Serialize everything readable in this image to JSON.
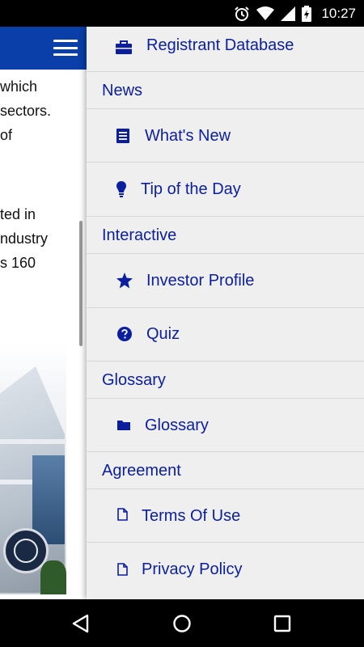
{
  "status_bar": {
    "time": "10:27",
    "icons": [
      "alarm-icon",
      "wifi-icon",
      "cellular-signal-icon",
      "battery-charging-icon"
    ]
  },
  "background_page": {
    "text_lines": [
      "which",
      "sectors.",
      "of",
      "ted in",
      "ndustry",
      "s 160"
    ],
    "menu_icon": "hamburger-icon",
    "header_color": "#0a3ea8"
  },
  "drawer": {
    "accent_color": "#0b1f9e",
    "registrant_database": {
      "label": "Registrant Database",
      "icon": "briefcase-icon"
    },
    "sections": {
      "news": "News",
      "interactive": "Interactive",
      "glossary": "Glossary",
      "agreement": "Agreement"
    },
    "items": {
      "whats_new": {
        "label": "What's New",
        "icon": "newspaper-icon"
      },
      "tip_of_the_day": {
        "label": "Tip of the Day",
        "icon": "lightbulb-icon"
      },
      "investor_profile": {
        "label": "Investor Profile",
        "icon": "star-icon"
      },
      "quiz": {
        "label": "Quiz",
        "icon": "question-circle-icon"
      },
      "glossary": {
        "label": "Glossary",
        "icon": "folder-icon"
      },
      "terms_of_use": {
        "label": "Terms Of Use",
        "icon": "file-icon"
      },
      "privacy_policy": {
        "label": "Privacy Policy",
        "icon": "file-icon"
      }
    }
  },
  "nav_bar": {
    "buttons": [
      "back-icon",
      "home-icon",
      "recents-icon"
    ]
  }
}
